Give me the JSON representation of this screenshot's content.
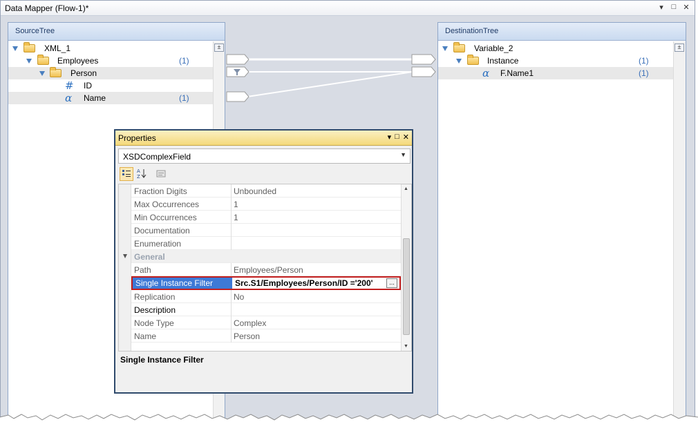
{
  "window": {
    "title": "Data Mapper (Flow-1)*",
    "controls": [
      "▾",
      "□",
      "✕"
    ]
  },
  "source_tree": {
    "header": "SourceTree",
    "collapse_symbol": "±",
    "nodes": [
      {
        "label": "XML_1",
        "count": ""
      },
      {
        "label": "Employees",
        "count": "(1)"
      },
      {
        "label": "Person",
        "count": ""
      },
      {
        "label": "ID",
        "count": "",
        "icon": "#"
      },
      {
        "label": "Name",
        "count": "(1)",
        "icon": "α"
      }
    ]
  },
  "destination_tree": {
    "header": "DestinationTree",
    "collapse_symbol": "±",
    "nodes": [
      {
        "label": "Variable_2",
        "count": ""
      },
      {
        "label": "Instance",
        "count": "(1)"
      },
      {
        "label": "F.Name1",
        "count": "(1)",
        "icon": "α"
      }
    ]
  },
  "properties": {
    "title": "Properties",
    "controls": [
      "▾",
      "□",
      "✕"
    ],
    "selected_object": "XSDComplexField",
    "toolbar": [
      "categorized-icon",
      "alphabetical-icon",
      "property-pages-icon"
    ],
    "rows": [
      {
        "name": "Fraction Digits",
        "value": "Unbounded"
      },
      {
        "name": "Max Occurrences",
        "value": "1"
      },
      {
        "name": "Min Occurrences",
        "value": "1"
      },
      {
        "name": "Documentation",
        "value": ""
      },
      {
        "name": "Enumeration",
        "value": ""
      },
      {
        "name": "General",
        "value": ""
      },
      {
        "name": "Path",
        "value": "Employees/Person"
      },
      {
        "name": "Single Instance Filter",
        "value": "Src.S1/Employees/Person/ID ='200'"
      },
      {
        "name": "Replication",
        "value": "No"
      },
      {
        "name": "Description",
        "value": ""
      },
      {
        "name": "Node Type",
        "value": "Complex"
      },
      {
        "name": "Name",
        "value": "Person"
      }
    ],
    "ellipsis": "...",
    "description_title": "Single Instance Filter"
  },
  "colors": {
    "accent_border": "#c21e1e",
    "selection": "#3d79d6",
    "count_text": "#3a6fb8"
  }
}
